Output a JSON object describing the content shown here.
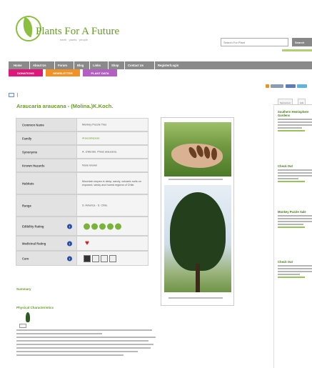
{
  "brand": {
    "name": "Plants For A Future",
    "tagline": "earth · plants · people",
    "colors": {
      "green": "#6a9a2b",
      "nav": "#8a8a8a",
      "pink": "#e0177a",
      "orange": "#f29222",
      "purple": "#b35fc4"
    }
  },
  "search": {
    "placeholder": "Search For Plant",
    "button": "Search"
  },
  "nav": {
    "items": [
      "Home",
      "About Us",
      "Forum",
      "Blog",
      "Links",
      "Shop",
      "Contact Us",
      "Register/Login"
    ],
    "subnav": [
      "DONATIONS",
      "NEWSLETTER",
      "PLANT DATA"
    ]
  },
  "plant": {
    "title": "Araucaria araucana - (Molina.)K.Koch."
  },
  "details": {
    "rows": [
      {
        "label": "Common Name",
        "value": "Monkey Puzzle Tree",
        "type": "text"
      },
      {
        "label": "Family",
        "value": "Araucariaceae",
        "type": "link"
      },
      {
        "label": "Synonyms",
        "value": "A. chilensis. Pinus araucana.",
        "type": "text"
      },
      {
        "label": "Known Hazards",
        "value": "None known",
        "type": "text"
      },
      {
        "label": "Habitats",
        "value": "Mountain slopes in deep, sandy, volcanic soils on exposed, windy and humid regions of Chile.",
        "type": "text"
      },
      {
        "label": "Range",
        "value": "S. America - S. Chile.",
        "type": "text"
      },
      {
        "label": "Edibility Rating",
        "value": "",
        "type": "rating",
        "rating": 5,
        "rating_max": 5
      },
      {
        "label": "Medicinal Rating",
        "value": "",
        "type": "heart"
      },
      {
        "label": "Care",
        "value": "",
        "type": "care"
      }
    ]
  },
  "photos": [
    {
      "alt": "seeds-in-hand"
    },
    {
      "alt": "monkey-puzzle-tree"
    }
  ],
  "sections": {
    "summary": "Summary",
    "physical": "Physical Characteristics"
  },
  "sidebar": {
    "tabs": [
      "Sponsored",
      "Ads"
    ],
    "ads": [
      {
        "title": "Southern Hemisphere Gardens"
      },
      {
        "title": "Check Out"
      },
      {
        "title": "Monkey Puzzle Sale"
      },
      {
        "title": "Check Out"
      }
    ]
  }
}
